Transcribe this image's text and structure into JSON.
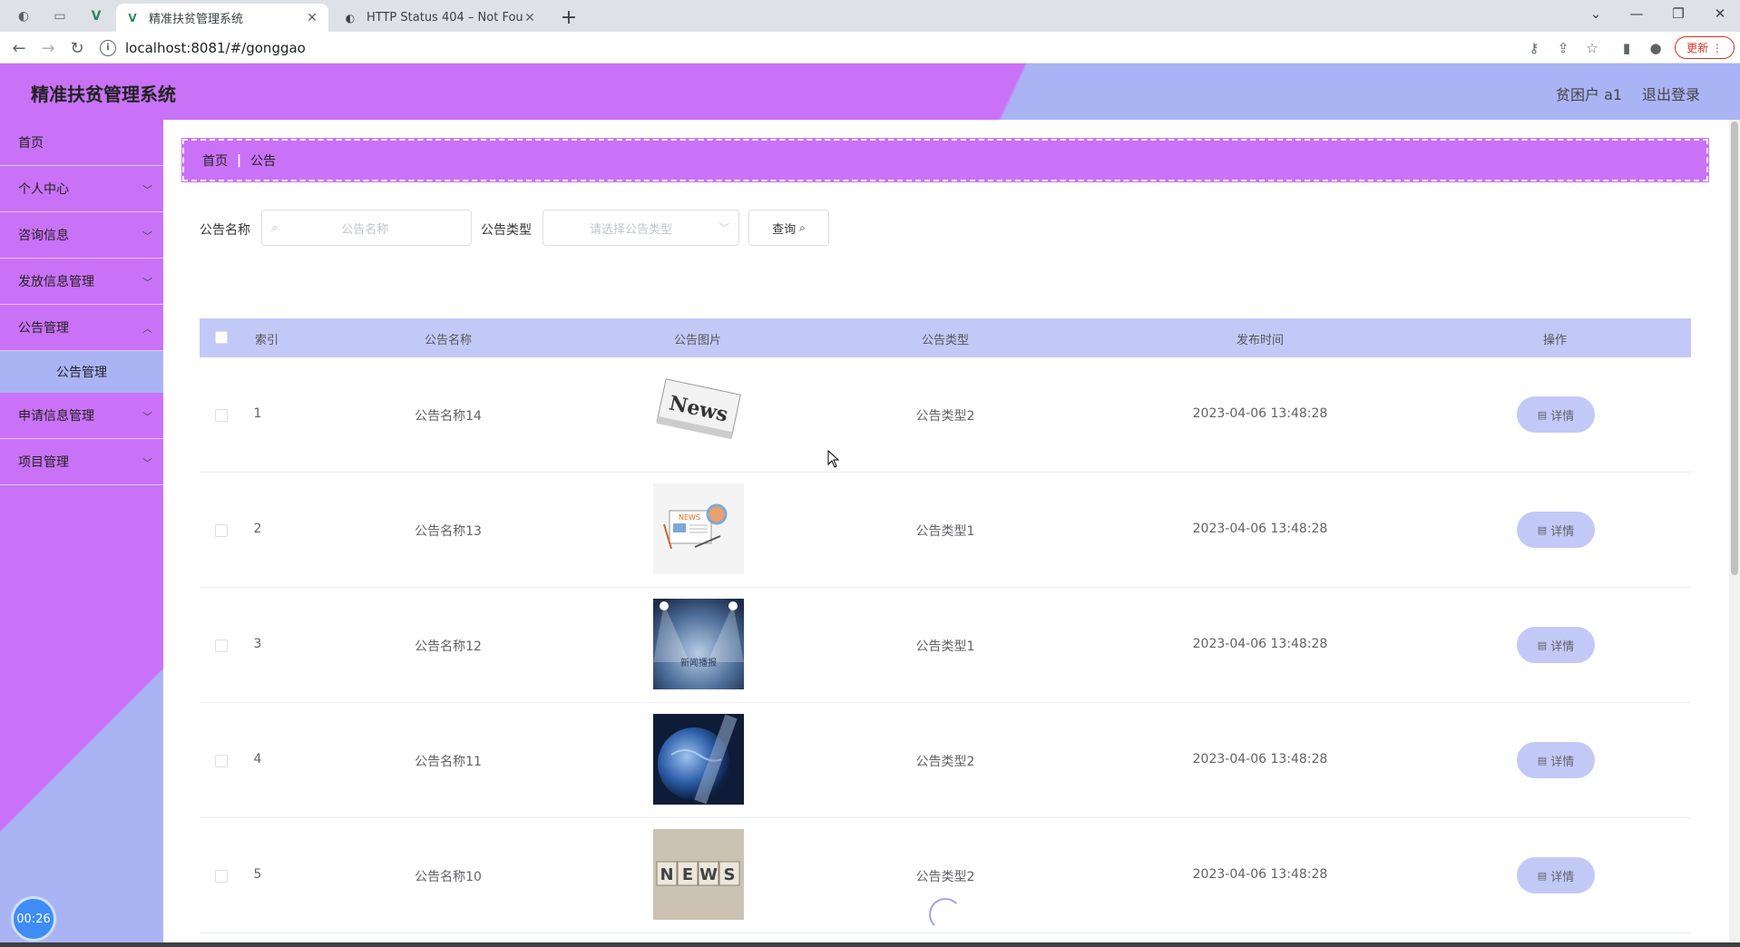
{
  "browser": {
    "tabs": [
      {
        "title": "精准扶贫管理系统",
        "active": true
      },
      {
        "title": "HTTP Status 404 – Not Found",
        "active": false
      }
    ],
    "url": "localhost:8081/#/gonggao",
    "update_label": "更新"
  },
  "header": {
    "title": "精准扶贫管理系统",
    "user": "贫困户 a1",
    "logout": "退出登录"
  },
  "sidebar": {
    "items": [
      {
        "label": "首页"
      },
      {
        "label": "个人中心"
      },
      {
        "label": "咨询信息"
      },
      {
        "label": "发放信息管理"
      },
      {
        "label": "公告管理"
      },
      {
        "label": "申请信息管理"
      },
      {
        "label": "项目管理"
      }
    ],
    "active_sub": "公告管理",
    "timer": "00:26"
  },
  "breadcrumb": {
    "home": "首页",
    "current": "公告"
  },
  "search": {
    "name_label": "公告名称",
    "name_placeholder": "公告名称",
    "type_label": "公告类型",
    "type_placeholder": "请选择公告类型",
    "query_label": "查询"
  },
  "table": {
    "headers": [
      "索引",
      "公告名称",
      "公告图片",
      "公告类型",
      "发布时间",
      "操作"
    ],
    "detail_label": "详情",
    "rows": [
      {
        "index": "1",
        "name": "公告名称14",
        "image": "news-paper",
        "type": "公告类型2",
        "time": "2023-04-06 13:48:28"
      },
      {
        "index": "2",
        "name": "公告名称13",
        "image": "news-illustration",
        "type": "公告类型1",
        "time": "2023-04-06 13:48:28"
      },
      {
        "index": "3",
        "name": "公告名称12",
        "image": "spotlight-stage",
        "type": "公告类型1",
        "time": "2023-04-06 13:48:28"
      },
      {
        "index": "4",
        "name": "公告名称11",
        "image": "globe",
        "type": "公告类型2",
        "time": "2023-04-06 13:48:28"
      },
      {
        "index": "5",
        "name": "公告名称10",
        "image": "news-blocks",
        "type": "公告类型2",
        "time": "2023-04-06 13:48:28"
      }
    ]
  },
  "image_text": {
    "news_paper": "News",
    "news_illus": "NEWS",
    "spotlight": "新闻播报",
    "blocks": [
      "N",
      "E",
      "W",
      "S"
    ]
  }
}
